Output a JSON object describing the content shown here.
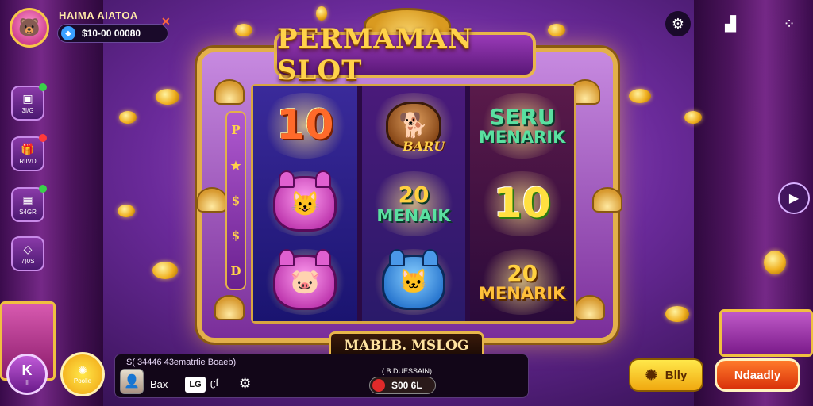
{
  "title": "PERMAMAN SLOT",
  "player": {
    "name": "HAIMA AIATOA",
    "balance": "$10-00 00080"
  },
  "side_buttons": [
    {
      "label": "3I/G",
      "icon": "wallet-icon",
      "badge": "#3ad04a"
    },
    {
      "label": "RIIVD",
      "icon": "gift-icon",
      "badge": "#ff3a3a"
    },
    {
      "label": "S4GR",
      "icon": "trophy-icon",
      "badge": "#3ad04a"
    },
    {
      "label": "7)0S",
      "icon": "tag-icon",
      "badge": ""
    }
  ],
  "strip_symbols": [
    "P",
    "★",
    "$",
    "$",
    "D"
  ],
  "reels": [
    [
      {
        "type": "num",
        "text": "10",
        "style": "red"
      },
      {
        "type": "animal",
        "kind": "pink"
      },
      {
        "type": "animal",
        "kind": "pink"
      }
    ],
    [
      {
        "type": "animal-label",
        "kind": "brown",
        "text": "BARU"
      },
      {
        "type": "word",
        "num": "20",
        "text": "MENAIK"
      },
      {
        "type": "animal",
        "kind": "blue"
      }
    ],
    [
      {
        "type": "word",
        "num": "SERU",
        "text": "MENARIK"
      },
      {
        "type": "num",
        "text": "10",
        "style": "green"
      },
      {
        "type": "word-gold",
        "num": "20",
        "text": "MENARIK"
      }
    ]
  ],
  "bottom_plate": "MABLB. MSLOG",
  "bottom_bar": {
    "info": "S( 34446   43ematrtie Boaeb)",
    "box": "Bax",
    "lg": "LG",
    "cf": "ʗf",
    "win_label": "( B DUESSAIN)",
    "win_value": "S00 6L"
  },
  "buttons": {
    "spin": "Blly",
    "auto": "Ndaadly",
    "left_label": "III",
    "left_round": "Poolie"
  },
  "colors": {
    "accent": "#e3b04a",
    "purple": "#7a2e9a"
  }
}
